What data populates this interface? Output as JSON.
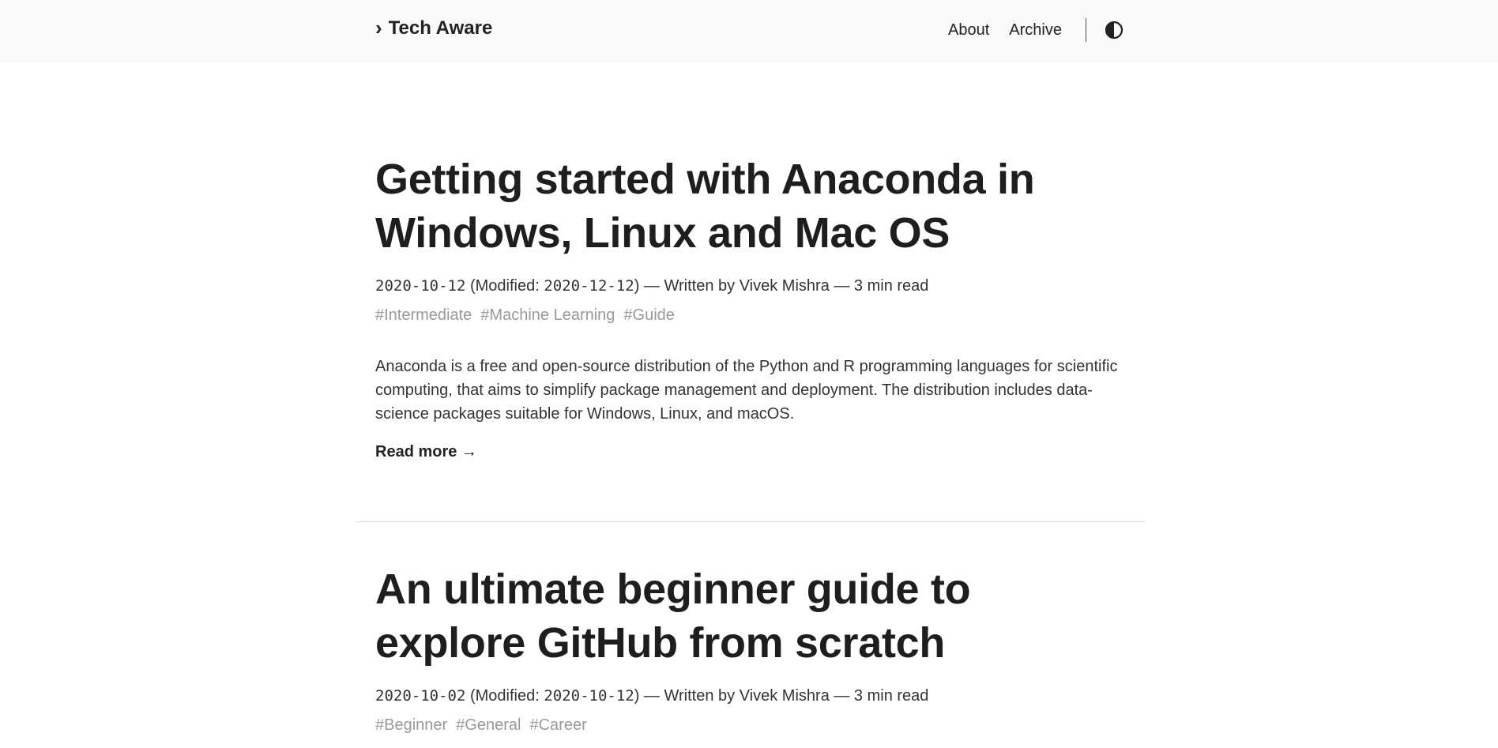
{
  "header": {
    "logo_text": "Tech Aware",
    "nav": [
      "About",
      "Archive"
    ]
  },
  "posts": [
    {
      "title_lines": [
        "Getting started with Anaconda in",
        "Windows, Linux and Mac OS"
      ],
      "date": "2020-10-12",
      "modified_prefix": " (Modified: ",
      "modified": "2020-12-12",
      "meta_suffix": ") — Written by Vivek Mishra — 3 min read",
      "tags": [
        "#Intermediate",
        "#Machine Learning",
        "#Guide"
      ],
      "summary": "Anaconda is a free and open-source distribution of the Python and R programming languages for scientific computing, that aims to simplify package management and deployment. The distribution includes data-science packages suitable for Windows, Linux, and macOS.",
      "read_more": "Read more →"
    },
    {
      "title_lines": [
        "An ultimate beginner guide to",
        "explore GitHub from scratch"
      ],
      "date": "2020-10-02",
      "modified_prefix": " (Modified: ",
      "modified": "2020-10-12",
      "meta_suffix": ") — Written by Vivek Mishra — 3 min read",
      "tags": [
        "#Beginner",
        "#General",
        "#Career"
      ]
    }
  ]
}
